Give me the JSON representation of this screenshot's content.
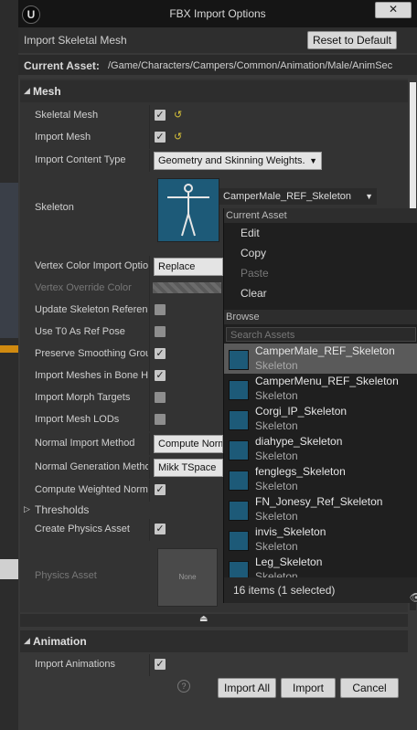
{
  "window": {
    "title": "FBX Import Options",
    "close_glyph": "✕"
  },
  "header": {
    "label": "Import Skeletal Mesh",
    "reset_button": "Reset to Default"
  },
  "current_asset": {
    "label": "Current Asset:",
    "path": "/Game/Characters/Campers/Common/Animation/Male/AnimSec"
  },
  "sections": {
    "mesh": "Mesh",
    "animation": "Animation"
  },
  "properties": [
    {
      "label": "Skeletal Mesh",
      "checked": true
    },
    {
      "label": "Import Mesh",
      "checked": true
    },
    {
      "label": "Import Content Type",
      "value": "Geometry and Skinning Weights."
    },
    {
      "label": "Skeleton",
      "value": "CamperMale_REF_Skeleton"
    },
    {
      "label": "Vertex Color Import Option",
      "value": "Replace"
    },
    {
      "label": "Vertex Override Color"
    },
    {
      "label": "Update Skeleton Reference Pose",
      "checked": false
    },
    {
      "label": "Use T0 As Ref Pose",
      "checked": false
    },
    {
      "label": "Preserve Smoothing Groups",
      "checked": true
    },
    {
      "label": "Import Meshes in Bone Hierarchy",
      "checked": true
    },
    {
      "label": "Import Morph Targets",
      "checked": false
    },
    {
      "label": "Import Mesh LODs",
      "checked": false
    },
    {
      "label": "Normal Import Method",
      "value": "Compute Normals"
    },
    {
      "label": "Normal Generation Method",
      "value": "Mikk TSpace"
    },
    {
      "label": "Compute Weighted Normals",
      "checked": true
    },
    {
      "label": "Thresholds"
    },
    {
      "label": "Create Physics Asset",
      "checked": true
    },
    {
      "label": "Physics Asset",
      "value": "None"
    },
    {
      "label": "Import Animations",
      "checked": true
    }
  ],
  "buttons": {
    "import_all": "Import All",
    "import": "Import",
    "cancel": "Cancel"
  },
  "popup": {
    "current_asset_header": "Current Asset",
    "menu": [
      "Edit",
      "Copy",
      "Paste",
      "Clear"
    ],
    "browse_header": "Browse",
    "search_placeholder": "Search Assets",
    "items": [
      {
        "name": "CamperMale_REF_Skeleton",
        "type": "Skeleton"
      },
      {
        "name": "CamperMenu_REF_Skeleton",
        "type": "Skeleton"
      },
      {
        "name": "Corgi_IP_Skeleton",
        "type": "Skeleton"
      },
      {
        "name": "diahype_Skeleton",
        "type": "Skeleton"
      },
      {
        "name": "fenglegs_Skeleton",
        "type": "Skeleton"
      },
      {
        "name": "FN_Jonesy_Ref_Skeleton",
        "type": "Skeleton"
      },
      {
        "name": "invis_Skeleton",
        "type": "Skeleton"
      },
      {
        "name": "Leg_Skeleton",
        "type": "Skeleton"
      }
    ],
    "footer": "16 items (1 selected)"
  },
  "colors": {
    "accent_yellow": "#d9c33a",
    "thumb_blue": "#1d5a78"
  }
}
